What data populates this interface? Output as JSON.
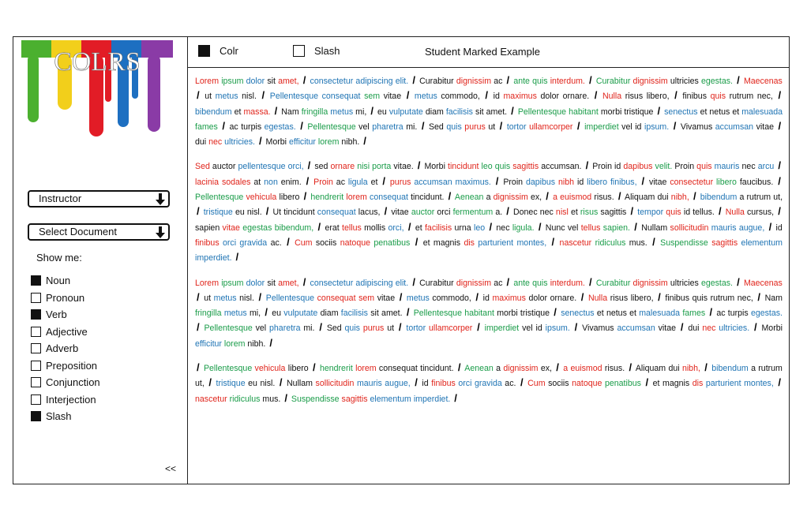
{
  "logo": {
    "text": "COLRS",
    "drip_colors": [
      "#4bb02f",
      "#f2cf1b",
      "#e21c26",
      "#1d6fc1",
      "#8a3ba6"
    ]
  },
  "sidebar": {
    "instructor_label": "Instructor",
    "document_label": "Select Document",
    "show_me_label": "Show me:",
    "options": [
      {
        "label": "Noun",
        "checked": true
      },
      {
        "label": "Pronoun",
        "checked": false
      },
      {
        "label": "Verb",
        "checked": true
      },
      {
        "label": "Adjective",
        "checked": false
      },
      {
        "label": "Adverb",
        "checked": false
      },
      {
        "label": "Preposition",
        "checked": false
      },
      {
        "label": "Conjunction",
        "checked": false
      },
      {
        "label": "Interjection",
        "checked": false
      },
      {
        "label": "Slash",
        "checked": true
      }
    ],
    "collapse_label": "<<"
  },
  "toolbar": {
    "colr_label": "Colr",
    "colr_checked": true,
    "slash_label": "Slash",
    "slash_checked": false,
    "example_title": "Student Marked Example"
  },
  "colors": {
    "noun": "#e0241b",
    "verb": "#1f74b4",
    "adjective": "#1a9c49",
    "plain": "#111111"
  },
  "paragraphs": [
    [
      [
        "n",
        "Lorem"
      ],
      [
        "a",
        "ipsum"
      ],
      [
        "v",
        "dolor"
      ],
      [
        "p",
        "sit"
      ],
      [
        "n",
        "amet,"
      ],
      [
        "s",
        "/"
      ],
      [
        "v",
        "consectetur adipiscing elit."
      ],
      [
        "s",
        "/"
      ],
      [
        "p",
        "Curabitur"
      ],
      [
        "n",
        "dignissim"
      ],
      [
        "p",
        "ac"
      ],
      [
        "s",
        "/"
      ],
      [
        "a",
        "ante quis"
      ],
      [
        "n",
        "interdum."
      ],
      [
        "s",
        "/"
      ],
      [
        "a",
        "Curabitur"
      ],
      [
        "n",
        "dignissim"
      ],
      [
        "p",
        "ultricies"
      ],
      [
        "a",
        "egestas."
      ],
      [
        "s",
        "/"
      ],
      [
        "n",
        "Maecenas"
      ],
      [
        "s",
        "/"
      ],
      [
        "p",
        "ut"
      ],
      [
        "v",
        "metus"
      ],
      [
        "p",
        "nisl."
      ],
      [
        "s",
        "/"
      ],
      [
        "v",
        "Pellentesque consequat"
      ],
      [
        "a",
        "sem"
      ],
      [
        "p",
        "vitae"
      ],
      [
        "s",
        "/"
      ],
      [
        "v",
        "metus"
      ],
      [
        "p",
        "commodo,"
      ],
      [
        "s",
        "/"
      ],
      [
        "p",
        "id"
      ],
      [
        "n",
        "maximus"
      ],
      [
        "p",
        "dolor ornare."
      ],
      [
        "s",
        "/"
      ],
      [
        "n",
        "Nulla"
      ],
      [
        "p",
        "risus libero,"
      ],
      [
        "s",
        "/"
      ],
      [
        "p",
        "finibus"
      ],
      [
        "n",
        "quis"
      ],
      [
        "p",
        "rutrum nec,"
      ],
      [
        "s",
        "/"
      ],
      [
        "v",
        "bibendum"
      ],
      [
        "p",
        "et"
      ],
      [
        "n",
        "massa."
      ],
      [
        "s",
        "/"
      ],
      [
        "p",
        "Nam"
      ],
      [
        "a",
        "fringilla"
      ],
      [
        "v",
        "metus"
      ],
      [
        "p",
        "mi,"
      ],
      [
        "s",
        "/"
      ],
      [
        "p",
        "eu"
      ],
      [
        "v",
        "vulputate"
      ],
      [
        "p",
        "diam"
      ],
      [
        "v",
        "facilisis"
      ],
      [
        "p",
        "sit amet."
      ],
      [
        "s",
        "/"
      ],
      [
        "a",
        "Pellentesque habitant"
      ],
      [
        "p",
        "morbi tristique"
      ],
      [
        "s",
        "/"
      ],
      [
        "v",
        "senectus"
      ],
      [
        "p",
        "et netus et"
      ],
      [
        "v",
        "malesuada"
      ],
      [
        "a",
        "fames"
      ],
      [
        "s",
        "/"
      ],
      [
        "p",
        "ac turpis"
      ],
      [
        "v",
        "egestas."
      ],
      [
        "s",
        "/"
      ],
      [
        "a",
        "Pellentesque"
      ],
      [
        "p",
        "vel"
      ],
      [
        "v",
        "pharetra"
      ],
      [
        "p",
        "mi."
      ],
      [
        "s",
        "/"
      ],
      [
        "p",
        "Sed"
      ],
      [
        "v",
        "quis"
      ],
      [
        "n",
        "purus"
      ],
      [
        "p",
        "ut"
      ],
      [
        "s",
        "/"
      ],
      [
        "v",
        "tortor"
      ],
      [
        "n",
        "ullamcorper"
      ],
      [
        "s",
        "/"
      ],
      [
        "a",
        "imperdiet"
      ],
      [
        "p",
        "vel id"
      ],
      [
        "v",
        "ipsum."
      ],
      [
        "s",
        "/"
      ],
      [
        "p",
        "Vivamus"
      ],
      [
        "v",
        "accumsan"
      ],
      [
        "p",
        "vitae"
      ],
      [
        "s",
        "/"
      ],
      [
        "p",
        "dui"
      ],
      [
        "n",
        "nec"
      ],
      [
        "v",
        "ultricies."
      ],
      [
        "s",
        "/"
      ],
      [
        "p",
        "Morbi"
      ],
      [
        "v",
        "efficitur"
      ],
      [
        "a",
        "lorem"
      ],
      [
        "p",
        "nibh."
      ],
      [
        "s",
        "/"
      ]
    ],
    [
      [
        "n",
        "Sed"
      ],
      [
        "p",
        "auctor"
      ],
      [
        "v",
        "pellentesque orci,"
      ],
      [
        "s",
        "/"
      ],
      [
        "p",
        "sed"
      ],
      [
        "n",
        "ornare"
      ],
      [
        "a",
        "nisi porta"
      ],
      [
        "p",
        "vitae."
      ],
      [
        "s",
        "/"
      ],
      [
        "p",
        "Morbi"
      ],
      [
        "n",
        "tincidunt"
      ],
      [
        "a",
        "leo quis"
      ],
      [
        "n",
        "sagittis"
      ],
      [
        "p",
        "accumsan."
      ],
      [
        "s",
        "/"
      ],
      [
        "p",
        "Proin id"
      ],
      [
        "n",
        "dapibus"
      ],
      [
        "a",
        "velit."
      ],
      [
        "p",
        "Proin"
      ],
      [
        "n",
        "quis"
      ],
      [
        "v",
        "mauris"
      ],
      [
        "p",
        "nec"
      ],
      [
        "v",
        "arcu"
      ],
      [
        "s",
        "/"
      ],
      [
        "n",
        "lacinia sodales"
      ],
      [
        "p",
        "at"
      ],
      [
        "v",
        "non"
      ],
      [
        "p",
        "enim."
      ],
      [
        "s",
        "/"
      ],
      [
        "n",
        "Proin"
      ],
      [
        "p",
        "ac"
      ],
      [
        "v",
        "ligula"
      ],
      [
        "p",
        "et"
      ],
      [
        "s",
        "/"
      ],
      [
        "n",
        "purus"
      ],
      [
        "v",
        "accumsan maximus."
      ],
      [
        "s",
        "/"
      ],
      [
        "p",
        "Proin"
      ],
      [
        "v",
        "dapibus"
      ],
      [
        "n",
        "nibh"
      ],
      [
        "p",
        "id"
      ],
      [
        "v",
        "libero finibus,"
      ],
      [
        "s",
        "/"
      ],
      [
        "p",
        "vitae"
      ],
      [
        "n",
        "consectetur"
      ],
      [
        "a",
        "libero"
      ],
      [
        "p",
        "faucibus."
      ],
      [
        "s",
        "/"
      ],
      [
        "a",
        "Pellentesque"
      ],
      [
        "n",
        "vehicula"
      ],
      [
        "p",
        "libero"
      ],
      [
        "s",
        "/"
      ],
      [
        "a",
        "hendrerit"
      ],
      [
        "n",
        "lorem"
      ],
      [
        "v",
        "consequat"
      ],
      [
        "p",
        "tincidunt."
      ],
      [
        "s",
        "/"
      ],
      [
        "a",
        "Aenean"
      ],
      [
        "p",
        "a"
      ],
      [
        "n",
        "dignissim"
      ],
      [
        "p",
        "ex,"
      ],
      [
        "s",
        "/"
      ],
      [
        "n",
        "a euismod"
      ],
      [
        "p",
        "risus."
      ],
      [
        "s",
        "/"
      ],
      [
        "p",
        "Aliquam dui"
      ],
      [
        "n",
        "nibh,"
      ],
      [
        "s",
        "/"
      ],
      [
        "v",
        "bibendum"
      ],
      [
        "p",
        "a rutrum ut,"
      ],
      [
        "s",
        "/"
      ],
      [
        "v",
        "tristique"
      ],
      [
        "p",
        "eu nisl."
      ],
      [
        "s",
        "/"
      ],
      [
        "p",
        "Ut tincidunt"
      ],
      [
        "v",
        "consequat"
      ],
      [
        "p",
        "lacus,"
      ],
      [
        "s",
        "/"
      ],
      [
        "p",
        "vitae"
      ],
      [
        "a",
        "auctor"
      ],
      [
        "p",
        "orci"
      ],
      [
        "a",
        "fermentum"
      ],
      [
        "p",
        "a."
      ],
      [
        "s",
        "/"
      ],
      [
        "p",
        "Donec nec"
      ],
      [
        "n",
        "nisl"
      ],
      [
        "p",
        "et"
      ],
      [
        "a",
        "risus"
      ],
      [
        "p",
        "sagittis"
      ],
      [
        "s",
        "/"
      ],
      [
        "v",
        "tempor"
      ],
      [
        "n",
        "quis"
      ],
      [
        "p",
        "id tellus."
      ],
      [
        "s",
        "/"
      ],
      [
        "n",
        "Nulla"
      ],
      [
        "p",
        "cursus,"
      ],
      [
        "s",
        "/"
      ],
      [
        "p",
        "sapien"
      ],
      [
        "n",
        "vitae"
      ],
      [
        "a",
        "egestas bibendum,"
      ],
      [
        "s",
        "/"
      ],
      [
        "p",
        "erat"
      ],
      [
        "n",
        "tellus"
      ],
      [
        "p",
        "mollis"
      ],
      [
        "v",
        "orci,"
      ],
      [
        "s",
        "/"
      ],
      [
        "p",
        "et"
      ],
      [
        "n",
        "facilisis"
      ],
      [
        "p",
        "urna"
      ],
      [
        "v",
        "leo"
      ],
      [
        "s",
        "/"
      ],
      [
        "p",
        "nec"
      ],
      [
        "a",
        "ligula."
      ],
      [
        "s",
        "/"
      ],
      [
        "p",
        "Nunc vel"
      ],
      [
        "n",
        "tellus"
      ],
      [
        "a",
        "sapien."
      ],
      [
        "s",
        "/"
      ],
      [
        "p",
        "Nullam"
      ],
      [
        "n",
        "sollicitudin"
      ],
      [
        "v",
        "mauris augue,"
      ],
      [
        "s",
        "/"
      ],
      [
        "p",
        "id"
      ],
      [
        "n",
        "finibus"
      ],
      [
        "v",
        "orci gravida"
      ],
      [
        "p",
        "ac."
      ],
      [
        "s",
        "/"
      ],
      [
        "n",
        "Cum"
      ],
      [
        "p",
        "sociis"
      ],
      [
        "n",
        "natoque"
      ],
      [
        "a",
        "penatibus"
      ],
      [
        "s",
        "/"
      ],
      [
        "p",
        "et magnis"
      ],
      [
        "n",
        "dis"
      ],
      [
        "v",
        "parturient montes,"
      ],
      [
        "s",
        "/"
      ],
      [
        "n",
        "nascetur"
      ],
      [
        "a",
        "ridiculus"
      ],
      [
        "p",
        "mus."
      ],
      [
        "s",
        "/"
      ],
      [
        "a",
        "Suspendisse"
      ],
      [
        "n",
        "sagittis"
      ],
      [
        "v",
        "elementum imperdiet."
      ],
      [
        "s",
        "/"
      ]
    ],
    [
      [
        "n",
        "Lorem"
      ],
      [
        "a",
        "ipsum"
      ],
      [
        "v",
        "dolor"
      ],
      [
        "p",
        "sit"
      ],
      [
        "n",
        "amet,"
      ],
      [
        "s",
        "/"
      ],
      [
        "v",
        "consectetur adipiscing elit."
      ],
      [
        "s",
        "/"
      ],
      [
        "p",
        "Curabitur"
      ],
      [
        "n",
        "dignissim"
      ],
      [
        "p",
        "ac"
      ],
      [
        "s",
        "/"
      ],
      [
        "a",
        "ante quis"
      ],
      [
        "n",
        "interdum."
      ],
      [
        "s",
        "/"
      ],
      [
        "a",
        "Curabitur"
      ],
      [
        "n",
        "dignissim"
      ],
      [
        "p",
        "ultricies"
      ],
      [
        "a",
        "egestas."
      ],
      [
        "s",
        "/"
      ],
      [
        "n",
        "Maecenas"
      ],
      [
        "s",
        "/"
      ],
      [
        "p",
        "ut"
      ],
      [
        "v",
        "metus"
      ],
      [
        "p",
        "nisl."
      ],
      [
        "s",
        "/"
      ],
      [
        "v",
        "Pellentesque"
      ],
      [
        "n",
        "consequat sem"
      ],
      [
        "p",
        "vitae"
      ],
      [
        "s",
        "/"
      ],
      [
        "v",
        "metus"
      ],
      [
        "p",
        "commodo,"
      ],
      [
        "s",
        "/"
      ],
      [
        "p",
        "id"
      ],
      [
        "n",
        "maximus"
      ],
      [
        "p",
        "dolor ornare."
      ],
      [
        "s",
        "/"
      ],
      [
        "n",
        "Nulla"
      ],
      [
        "p",
        "risus libero,"
      ],
      [
        "s",
        "/"
      ],
      [
        "p",
        "finibus quis rutrum nec,"
      ],
      [
        "s",
        "/"
      ],
      [
        "p",
        "Nam"
      ],
      [
        "a",
        "fringilla"
      ],
      [
        "v",
        "metus"
      ],
      [
        "p",
        "mi,"
      ],
      [
        "s",
        "/"
      ],
      [
        "p",
        "eu"
      ],
      [
        "v",
        "vulputate"
      ],
      [
        "p",
        "diam"
      ],
      [
        "v",
        "facilisis"
      ],
      [
        "p",
        "sit amet."
      ],
      [
        "s",
        "/"
      ],
      [
        "a",
        "Pellentesque habitant"
      ],
      [
        "p",
        "morbi tristique"
      ],
      [
        "s",
        "/"
      ],
      [
        "v",
        "senectus"
      ],
      [
        "p",
        "et netus et"
      ],
      [
        "v",
        "malesuada"
      ],
      [
        "a",
        "fames"
      ],
      [
        "s",
        "/"
      ],
      [
        "p",
        "ac turpis"
      ],
      [
        "v",
        "egestas."
      ],
      [
        "s",
        "/"
      ],
      [
        "a",
        "Pellentesque"
      ],
      [
        "p",
        "vel"
      ],
      [
        "v",
        "pharetra"
      ],
      [
        "p",
        "mi."
      ],
      [
        "s",
        "/"
      ],
      [
        "p",
        "Sed"
      ],
      [
        "v",
        "quis"
      ],
      [
        "n",
        "purus"
      ],
      [
        "p",
        "ut"
      ],
      [
        "s",
        "/"
      ],
      [
        "v",
        "tortor"
      ],
      [
        "n",
        "ullamcorper"
      ],
      [
        "s",
        "/"
      ],
      [
        "a",
        "imperdiet"
      ],
      [
        "p",
        "vel id"
      ],
      [
        "v",
        "ipsum."
      ],
      [
        "s",
        "/"
      ],
      [
        "p",
        "Vivamus"
      ],
      [
        "v",
        "accumsan"
      ],
      [
        "p",
        "vitae"
      ],
      [
        "s",
        "/"
      ],
      [
        "p",
        "dui"
      ],
      [
        "n",
        "nec"
      ],
      [
        "v",
        "ultricies."
      ],
      [
        "s",
        "/"
      ],
      [
        "p",
        "Morbi"
      ],
      [
        "v",
        "efficitur"
      ],
      [
        "a",
        "lorem"
      ],
      [
        "p",
        "nibh."
      ],
      [
        "s",
        "/"
      ]
    ],
    [
      [
        "s",
        "/"
      ],
      [
        "a",
        "Pellentesque"
      ],
      [
        "n",
        "vehicula"
      ],
      [
        "p",
        "libero"
      ],
      [
        "s",
        "/"
      ],
      [
        "a",
        "hendrerit"
      ],
      [
        "n",
        "lorem"
      ],
      [
        "p",
        "consequat tincidunt."
      ],
      [
        "s",
        "/"
      ],
      [
        "a",
        "Aenean"
      ],
      [
        "p",
        "a"
      ],
      [
        "n",
        "dignissim"
      ],
      [
        "p",
        "ex,"
      ],
      [
        "s",
        "/"
      ],
      [
        "n",
        "a euismod"
      ],
      [
        "p",
        "risus."
      ],
      [
        "s",
        "/"
      ],
      [
        "p",
        "Aliquam dui"
      ],
      [
        "n",
        "nibh,"
      ],
      [
        "s",
        "/"
      ],
      [
        "v",
        "bibendum"
      ],
      [
        "p",
        "a rutrum ut,"
      ],
      [
        "s",
        "/"
      ],
      [
        "v",
        "tristique"
      ],
      [
        "p",
        "eu nisl."
      ],
      [
        "s",
        "/"
      ],
      [
        "p",
        "Nullam"
      ],
      [
        "n",
        "sollicitudin"
      ],
      [
        "v",
        "mauris augue,"
      ],
      [
        "s",
        "/"
      ],
      [
        "p",
        "id"
      ],
      [
        "n",
        "finibus"
      ],
      [
        "v",
        "orci gravida"
      ],
      [
        "p",
        "ac."
      ],
      [
        "s",
        "/"
      ],
      [
        "n",
        "Cum"
      ],
      [
        "p",
        "sociis"
      ],
      [
        "n",
        "natoque"
      ],
      [
        "a",
        "penatibus"
      ],
      [
        "s",
        "/"
      ],
      [
        "p",
        "et magnis"
      ],
      [
        "n",
        "dis"
      ],
      [
        "v",
        "parturient montes,"
      ],
      [
        "s",
        "/"
      ],
      [
        "n",
        "nascetur"
      ],
      [
        "a",
        "ridiculus"
      ],
      [
        "p",
        "mus."
      ],
      [
        "s",
        "/"
      ],
      [
        "a",
        "Suspendisse"
      ],
      [
        "n",
        "sagittis"
      ],
      [
        "v",
        "elementum imperdiet."
      ],
      [
        "s",
        "/"
      ]
    ]
  ]
}
